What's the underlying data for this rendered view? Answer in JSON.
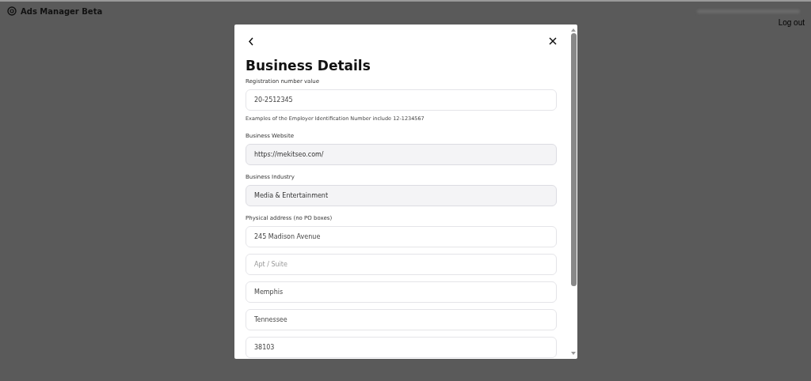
{
  "header": {
    "app_title": "Ads Manager Beta",
    "logout": "Log out"
  },
  "dialog": {
    "title": "Business Details",
    "sections": [
      {
        "label": "Registration number value",
        "fields": [
          {
            "value": "20-2512345",
            "disabled": false
          }
        ],
        "help": "Examples of the Employer Identification Number include 12-1234567"
      },
      {
        "label": "Business Website",
        "fields": [
          {
            "value": "https://mekitseo.com/",
            "disabled": true
          }
        ]
      },
      {
        "label": "Business Industry",
        "fields": [
          {
            "value": "Media & Entertainment",
            "disabled": true
          }
        ]
      },
      {
        "label": "Physical address (no PO boxes)",
        "fields": [
          {
            "value": "245 Madison Avenue",
            "disabled": false
          },
          {
            "placeholder": "Apt / Suite",
            "disabled": false
          },
          {
            "value": "Memphis",
            "disabled": false
          },
          {
            "value": "Tennessee",
            "disabled": false
          },
          {
            "value": "38103",
            "disabled": false
          }
        ]
      }
    ]
  }
}
